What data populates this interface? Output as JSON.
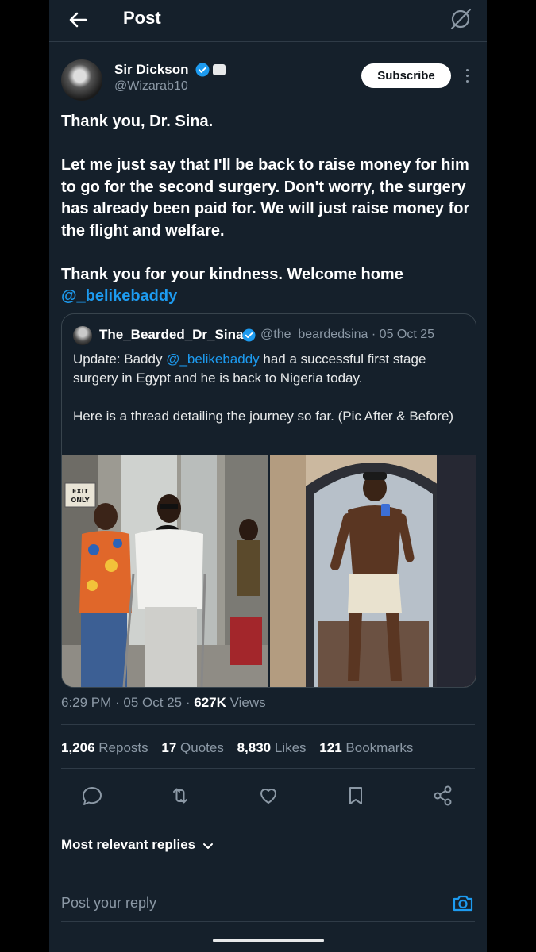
{
  "header": {
    "title": "Post"
  },
  "author": {
    "name": "Sir Dickson",
    "handle": "@Wizarab10",
    "subscribe_label": "Subscribe"
  },
  "post": {
    "paragraphs": [
      "Thank you, Dr. Sina.",
      "Let me just say that I'll be back to raise money for him to go for the second surgery. Don't worry, the surgery has already been paid for. We will just raise money for the flight and welfare.",
      "Thank you for your kindness. Welcome home"
    ],
    "mention": "@_belikebaddy"
  },
  "quote": {
    "name": "The_Bearded_Dr_Sina",
    "handle": "@the_beardedsina",
    "date": "· 05 Oct 25",
    "line1_pre": "Update: Baddy ",
    "line1_mention": "@_belikebaddy",
    "line1_post": " had a successful first stage surgery in Egypt and he is back to Nigeria today.",
    "line2": "Here is a thread detailing the journey so far. (Pic After & Before)",
    "exit_sign": "EXIT ONLY"
  },
  "meta": {
    "time": "6:29 PM · 05 Oct 25 · ",
    "views_count": "627K",
    "views_label": " Views"
  },
  "stats": {
    "reposts_count": "1,206",
    "reposts_label": "Reposts",
    "quotes_count": "17",
    "quotes_label": "Quotes",
    "likes_count": "8,830",
    "likes_label": "Likes",
    "bookmarks_count": "121",
    "bookmarks_label": "Bookmarks"
  },
  "replies": {
    "sort_label": "Most relevant replies",
    "placeholder": "Post your reply"
  },
  "colors": {
    "background": "#15202b",
    "accent": "#1d9bf0",
    "text": "#e7e9ea",
    "muted": "#8b98a5"
  }
}
